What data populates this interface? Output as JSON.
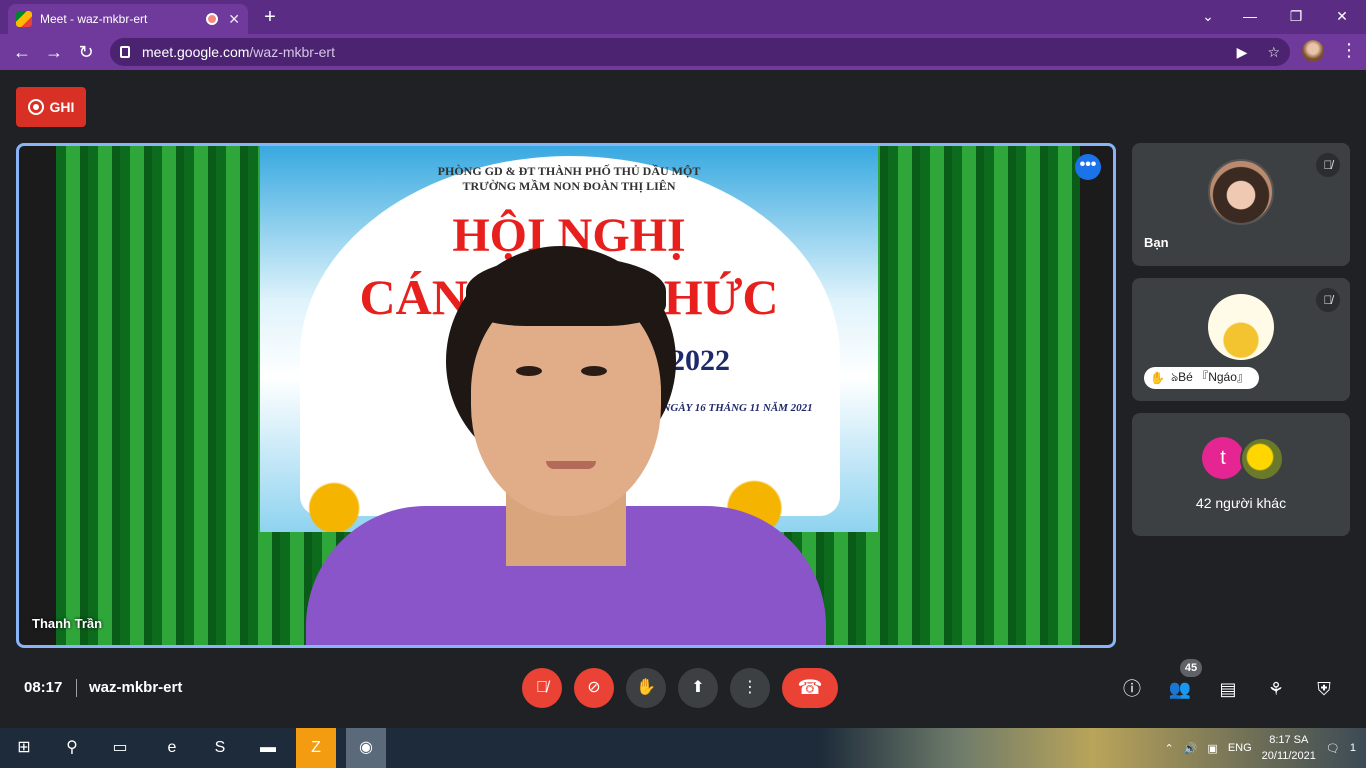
{
  "browser": {
    "tab_title": "Meet - waz-mkbr-ert",
    "tab_close": "✕",
    "new_tab": "+",
    "url_host": "meet.google.com",
    "url_path": "/waz-mkbr-ert",
    "win_min": "—",
    "win_max": "❐",
    "win_close": "✕"
  },
  "meet": {
    "record_label": "GHI",
    "main_tile": {
      "name": "Thanh Trần",
      "banner_line1": "PHÒNG GD & ĐT THÀNH PHỐ THỦ DẦU MỘT",
      "banner_line2": "TRƯỜNG MẦM NON ĐOÀN THỊ LIÊN",
      "banner_title1": "HỘI NGHỊ",
      "banner_title2": "CÁN B    IÊN CHỨC",
      "banner_year": "21-2022",
      "banner_date": "LỢI, NGÀY 16 THÁNG 11 NĂM 2021"
    },
    "side_tiles": [
      {
        "name": "Bạn",
        "muted": true
      },
      {
        "name": "ঌBé 『Ngáo』",
        "muted": true,
        "hand_raised": true
      },
      {
        "avatar_letter": "t",
        "label": "42 người khác"
      }
    ],
    "bottom": {
      "time": "08:17",
      "meeting_code": "waz-mkbr-ert",
      "participant_count": "45"
    }
  },
  "taskbar": {
    "lang": "ENG",
    "time": "8:17 SA",
    "date": "20/11/2021",
    "notifications": "1"
  },
  "colors": {
    "accent": "#8ab4f8",
    "danger": "#ea4335",
    "chrome_purple": "#5b2c83"
  }
}
